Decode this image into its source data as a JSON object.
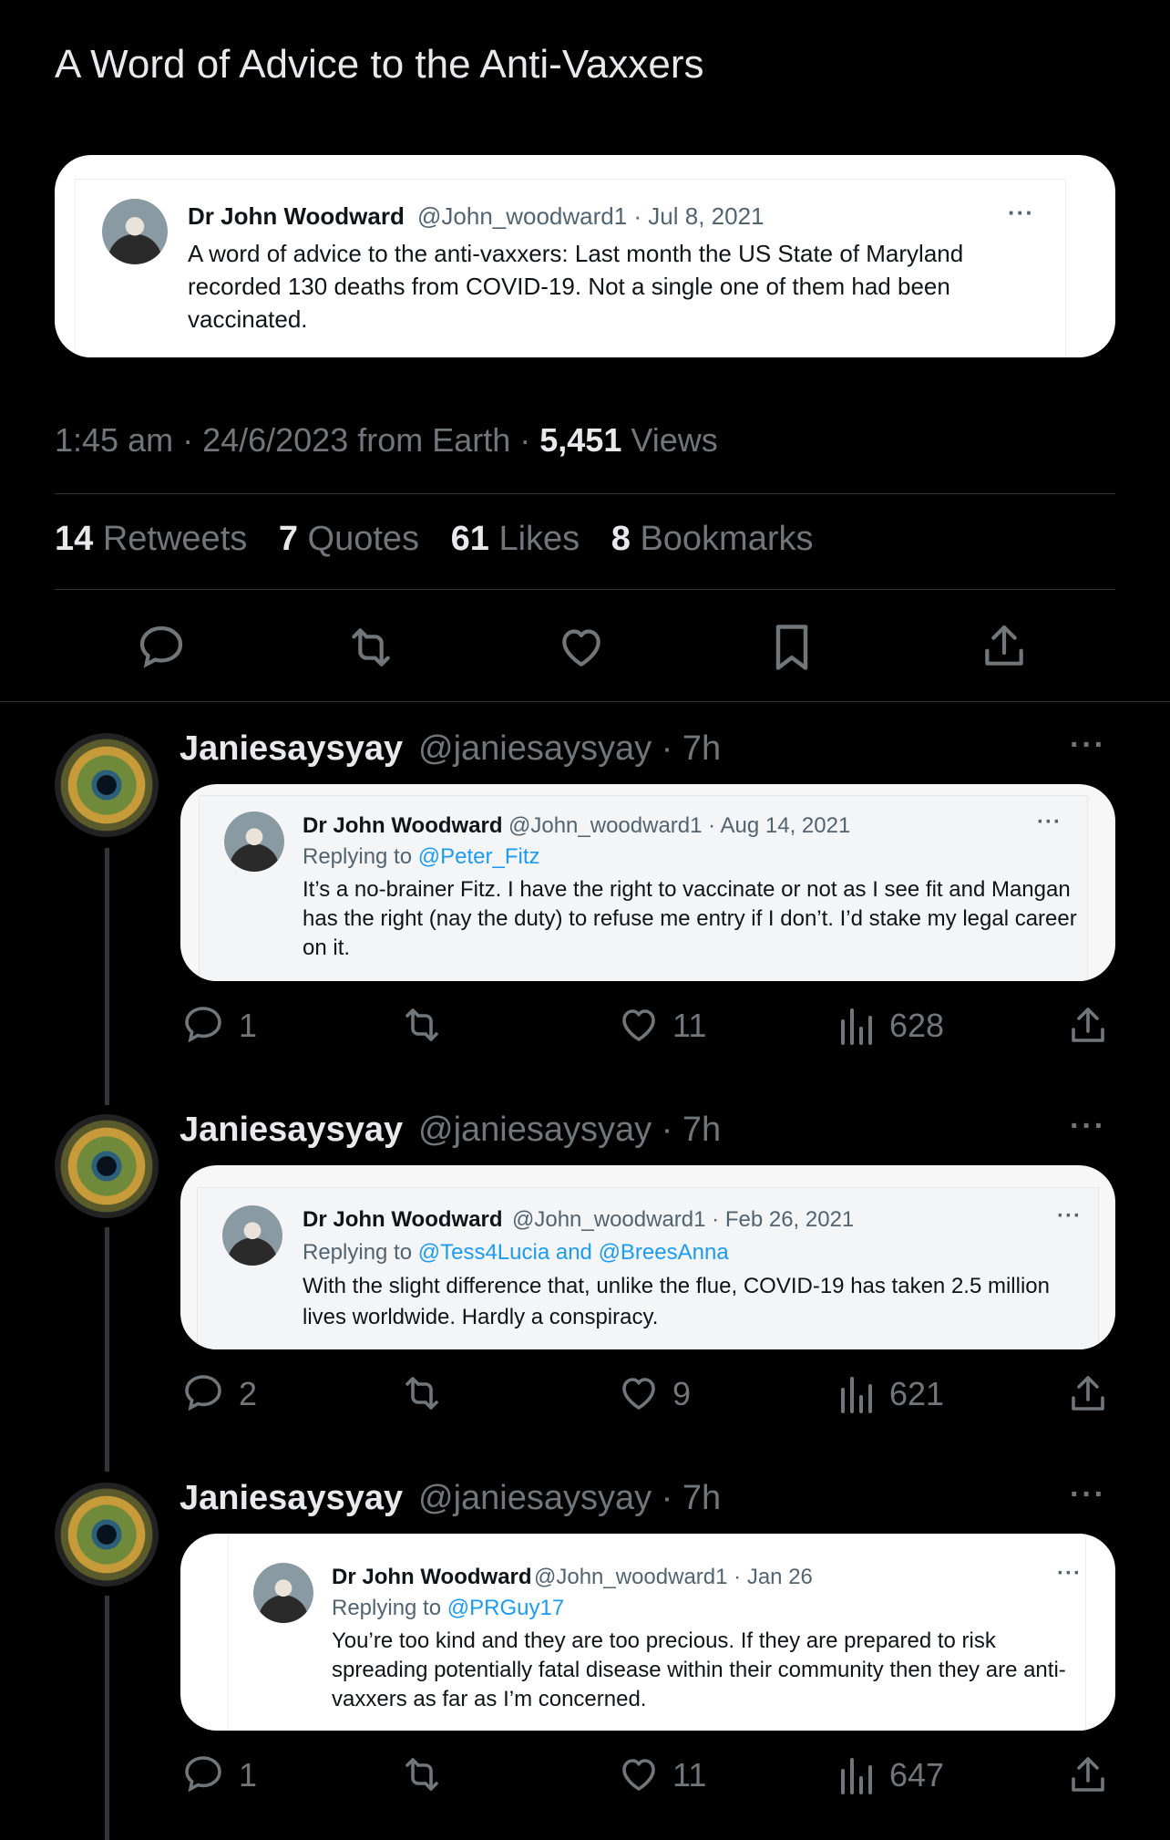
{
  "page_title": "A Word of Advice to the Anti-Vaxxers",
  "main_embed": {
    "name": "Dr John Woodward",
    "meta": "@John_woodward1 · Jul 8, 2021",
    "text": "A word of advice to the anti-vaxxers:  Last month the US State of Maryland recorded 130 deaths from COVID-19.  Not a single one of them had been vaccinated.",
    "more": "···"
  },
  "post_meta": {
    "time": "1:45 am · 24/6/2023 from Earth · ",
    "views_count": "5,451",
    "views_label": " Views"
  },
  "stats": [
    {
      "count": "14",
      "label": "Retweets"
    },
    {
      "count": "7",
      "label": "Quotes"
    },
    {
      "count": "61",
      "label": "Likes"
    },
    {
      "count": "8",
      "label": "Bookmarks"
    }
  ],
  "replies": [
    {
      "user": "Janiesaysyay",
      "handle_time": "@janiesaysyay · 7h",
      "more": "···",
      "embed": {
        "name": "Dr John Woodward",
        "meta": "@John_woodward1 · Aug 14, 2021",
        "reply_prefix": "Replying to ",
        "reply_to": "@Peter_Fitz",
        "text": "It’s a no-brainer Fitz. I have the right to vaccinate or not as I see fit and Mangan has the right (nay the duty) to refuse me entry if I don’t.  I’d stake my legal career on it.",
        "more": "···"
      },
      "replies_count": "1",
      "likes": "11",
      "views": "628"
    },
    {
      "user": "Janiesaysyay",
      "handle_time": "@janiesaysyay · 7h",
      "more": "···",
      "embed": {
        "name": "Dr John Woodward",
        "meta": "@John_woodward1 · Feb 26, 2021",
        "reply_prefix": "Replying to ",
        "reply_to": "@Tess4Lucia and @BreesAnna",
        "text": "With the slight difference that, unlike the flue, COVID-19 has taken 2.5 million lives worldwide. Hardly a conspiracy.",
        "more": "···"
      },
      "replies_count": "2",
      "likes": "9",
      "views": "621"
    },
    {
      "user": "Janiesaysyay",
      "handle_time": "@janiesaysyay · 7h",
      "more": "···",
      "embed": {
        "name": "Dr John Woodward",
        "meta": "@John_woodward1 · Jan 26",
        "reply_prefix": "Replying to ",
        "reply_to": "@PRGuy17",
        "text": "You’re too kind and they are too precious. If they are prepared to risk spreading potentially fatal disease within their community then they are anti-vaxxers as far as I’m concerned.",
        "more": "···"
      },
      "replies_count": "1",
      "likes": "11",
      "views": "647"
    }
  ]
}
